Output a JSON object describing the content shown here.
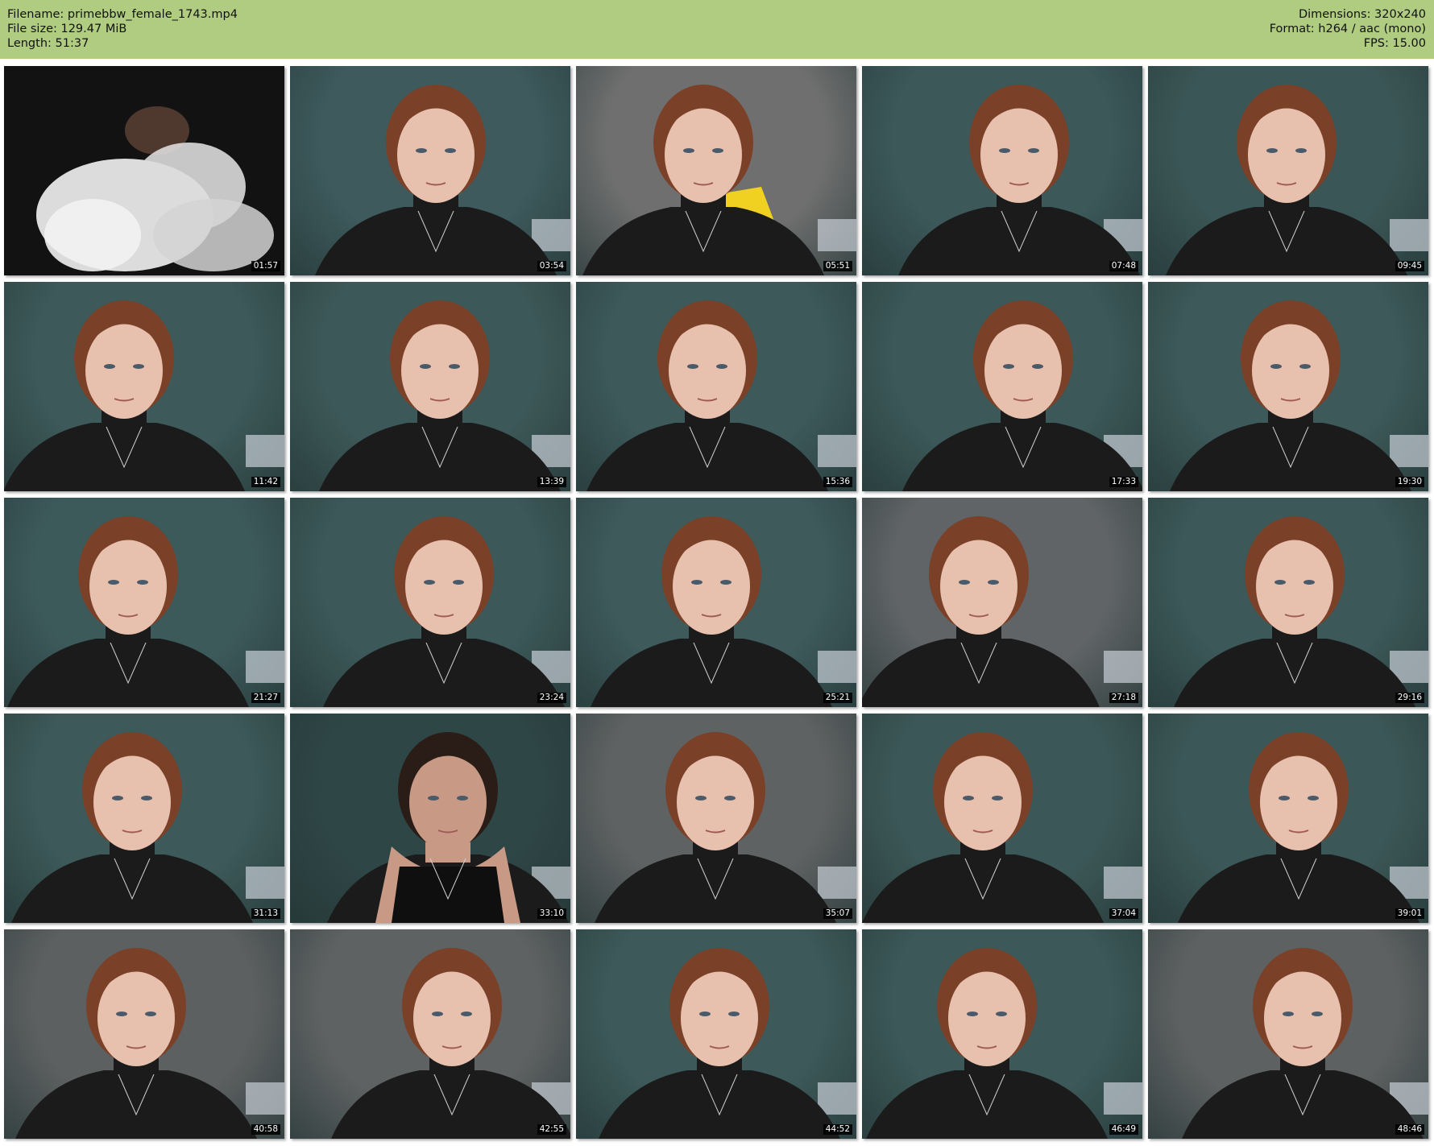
{
  "header": {
    "filename": "Filename: primebbw_female_1743.mp4",
    "filesize": "File size: 129.47 MiB",
    "length": "Length: 51:37",
    "dimensions": "Dimensions: 320x240",
    "format": "Format: h264 / aac (mono)",
    "fps": "FPS: 15.00",
    "background_color": "#b0cc80"
  },
  "thumbnails": [
    {
      "timestamp": "01:57",
      "scene": "smoke",
      "bg": "#111111"
    },
    {
      "timestamp": "03:54",
      "scene": "face",
      "bg": "#3e5a5c"
    },
    {
      "timestamp": "05:51",
      "scene": "face-chair",
      "bg": "#6f6f6f"
    },
    {
      "timestamp": "07:48",
      "scene": "face",
      "bg": "#3c5859"
    },
    {
      "timestamp": "09:45",
      "scene": "face",
      "bg": "#3b5656"
    },
    {
      "timestamp": "11:42",
      "scene": "face",
      "bg": "#3d5959"
    },
    {
      "timestamp": "13:39",
      "scene": "face-tilt",
      "bg": "#3d5858"
    },
    {
      "timestamp": "15:36",
      "scene": "face",
      "bg": "#3d595a"
    },
    {
      "timestamp": "17:33",
      "scene": "face",
      "bg": "#3c5858"
    },
    {
      "timestamp": "19:30",
      "scene": "face",
      "bg": "#3d5959"
    },
    {
      "timestamp": "21:27",
      "scene": "face",
      "bg": "#3d5a5b"
    },
    {
      "timestamp": "23:24",
      "scene": "face",
      "bg": "#3c5858"
    },
    {
      "timestamp": "25:21",
      "scene": "face",
      "bg": "#3e5a5b"
    },
    {
      "timestamp": "27:18",
      "scene": "face",
      "bg": "#606466"
    },
    {
      "timestamp": "29:16",
      "scene": "face",
      "bg": "#3c5858"
    },
    {
      "timestamp": "31:13",
      "scene": "face",
      "bg": "#3d5959"
    },
    {
      "timestamp": "33:10",
      "scene": "face-dark",
      "bg": "#2f4646"
    },
    {
      "timestamp": "35:07",
      "scene": "face",
      "bg": "#5f6263"
    },
    {
      "timestamp": "37:04",
      "scene": "face",
      "bg": "#3c5757"
    },
    {
      "timestamp": "39:01",
      "scene": "face",
      "bg": "#3c5757"
    },
    {
      "timestamp": "40:58",
      "scene": "face",
      "bg": "#5d6061"
    },
    {
      "timestamp": "42:55",
      "scene": "face",
      "bg": "#5f6263"
    },
    {
      "timestamp": "44:52",
      "scene": "face",
      "bg": "#3d5959"
    },
    {
      "timestamp": "46:49",
      "scene": "face",
      "bg": "#3c5858"
    },
    {
      "timestamp": "48:46",
      "scene": "face",
      "bg": "#5e6162"
    }
  ]
}
